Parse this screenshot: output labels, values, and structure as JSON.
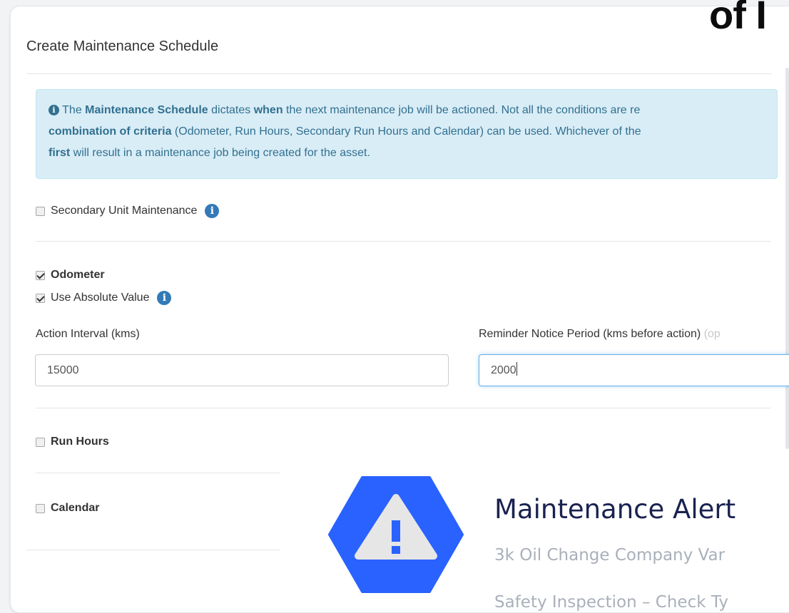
{
  "modal": {
    "title": "Create Maintenance Schedule",
    "info_box": {
      "seg1": "The ",
      "seg2": "Maintenance Schedule",
      "seg3": " dictates ",
      "seg4": "when",
      "seg5": " the next maintenance job will be actioned. Not all the conditions are re",
      "seg6": "combination of criteria",
      "seg7": " (Odometer, Run Hours, Secondary Run Hours and Calendar) can be used. Whichever of the",
      "seg8": "first",
      "seg9": " will result in a maintenance job being created for the asset."
    },
    "secondary_unit": {
      "label": "Secondary Unit Maintenance",
      "checked": false
    },
    "odometer": {
      "label": "Odometer",
      "checked": true,
      "use_absolute": {
        "label": "Use Absolute Value",
        "checked": true
      },
      "action_interval": {
        "label": "Action Interval (kms)",
        "value": "15000"
      },
      "reminder": {
        "label": "Reminder Notice Period (kms before action)",
        "optional": "(op",
        "value": "2000"
      }
    },
    "run_hours": {
      "label": "Run Hours",
      "checked": false
    },
    "calendar": {
      "label": "Calendar",
      "checked": false
    }
  },
  "overlay": {
    "brand_text": "of I",
    "alert_title": "Maintenance Alert",
    "items": [
      "3k Oil Change Company Var",
      "Safety Inspection – Check Ty"
    ]
  },
  "colors": {
    "badge": "#2962ff",
    "info_bg": "#d9edf7",
    "title": "#1a2250"
  },
  "icons": [
    "info-circle-icon",
    "warning-triangle-icon",
    "checkbox-icon"
  ]
}
